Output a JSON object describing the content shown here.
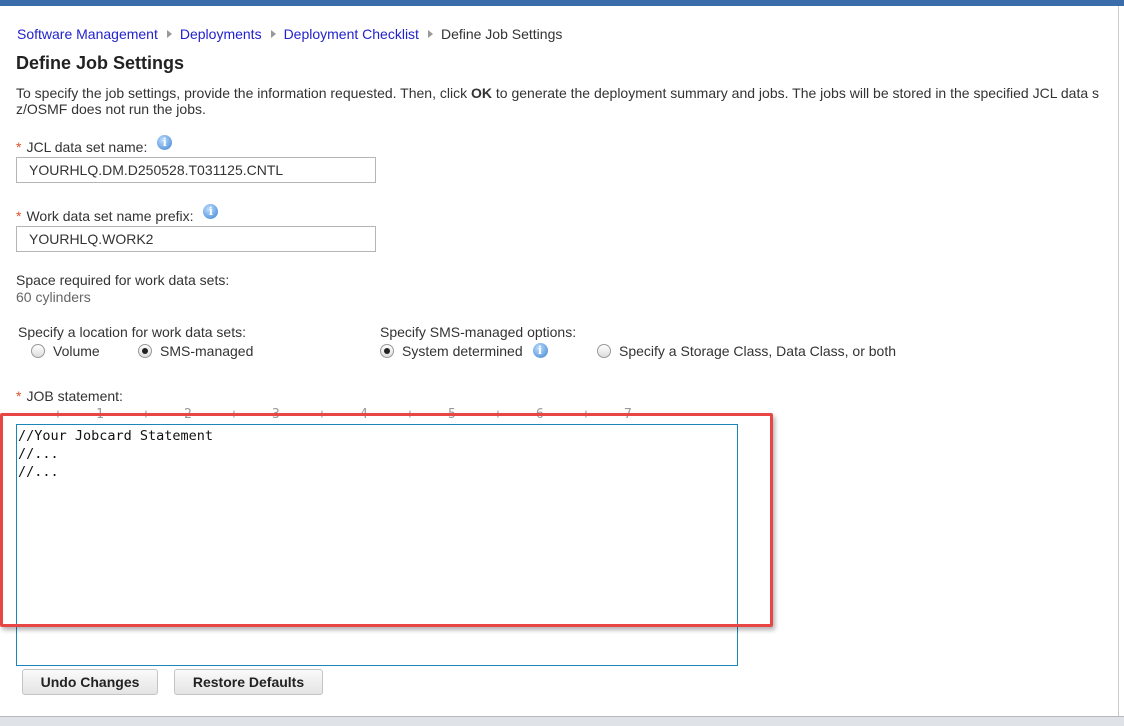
{
  "breadcrumb": [
    "Software Management",
    "Deployments",
    "Deployment Checklist",
    "Define Job Settings"
  ],
  "page_title": "Define Job Settings",
  "intro": {
    "before_ok": "To specify the job settings, provide the information requested. Then, click ",
    "ok": "OK",
    "after_ok": " to generate the deployment summary and jobs. The jobs will be stored in the specified JCL data s",
    "line2": "z/OSMF does not run the jobs."
  },
  "required_mark": "*",
  "jcl": {
    "label": "JCL data set name:",
    "value": "YOURHLQ.DM.D250528.T031125.CNTL"
  },
  "work_prefix": {
    "label": "Work data set name prefix:",
    "value": "YOURHLQ.WORK2"
  },
  "space": {
    "label": "Space required for work data sets:",
    "value": "60 cylinders"
  },
  "location": {
    "label": "Specify a location for work data sets:",
    "options": [
      "Volume",
      "SMS-managed"
    ],
    "selected": "SMS-managed"
  },
  "sms": {
    "label": "Specify SMS-managed options:",
    "options": [
      "System determined",
      "Specify a Storage Class, Data Class, or both"
    ],
    "selected": "System determined"
  },
  "job": {
    "label": "JOB statement:",
    "ruler": [
      "+",
      "1",
      "+",
      "2",
      "+",
      "3",
      "+",
      "4",
      "+",
      "5",
      "+",
      "6",
      "+",
      "7"
    ],
    "value": "//Your Jobcard Statement\n//...\n//..."
  },
  "buttons": {
    "undo": "Undo Changes",
    "restore": "Restore Defaults"
  },
  "info_glyph": "i"
}
